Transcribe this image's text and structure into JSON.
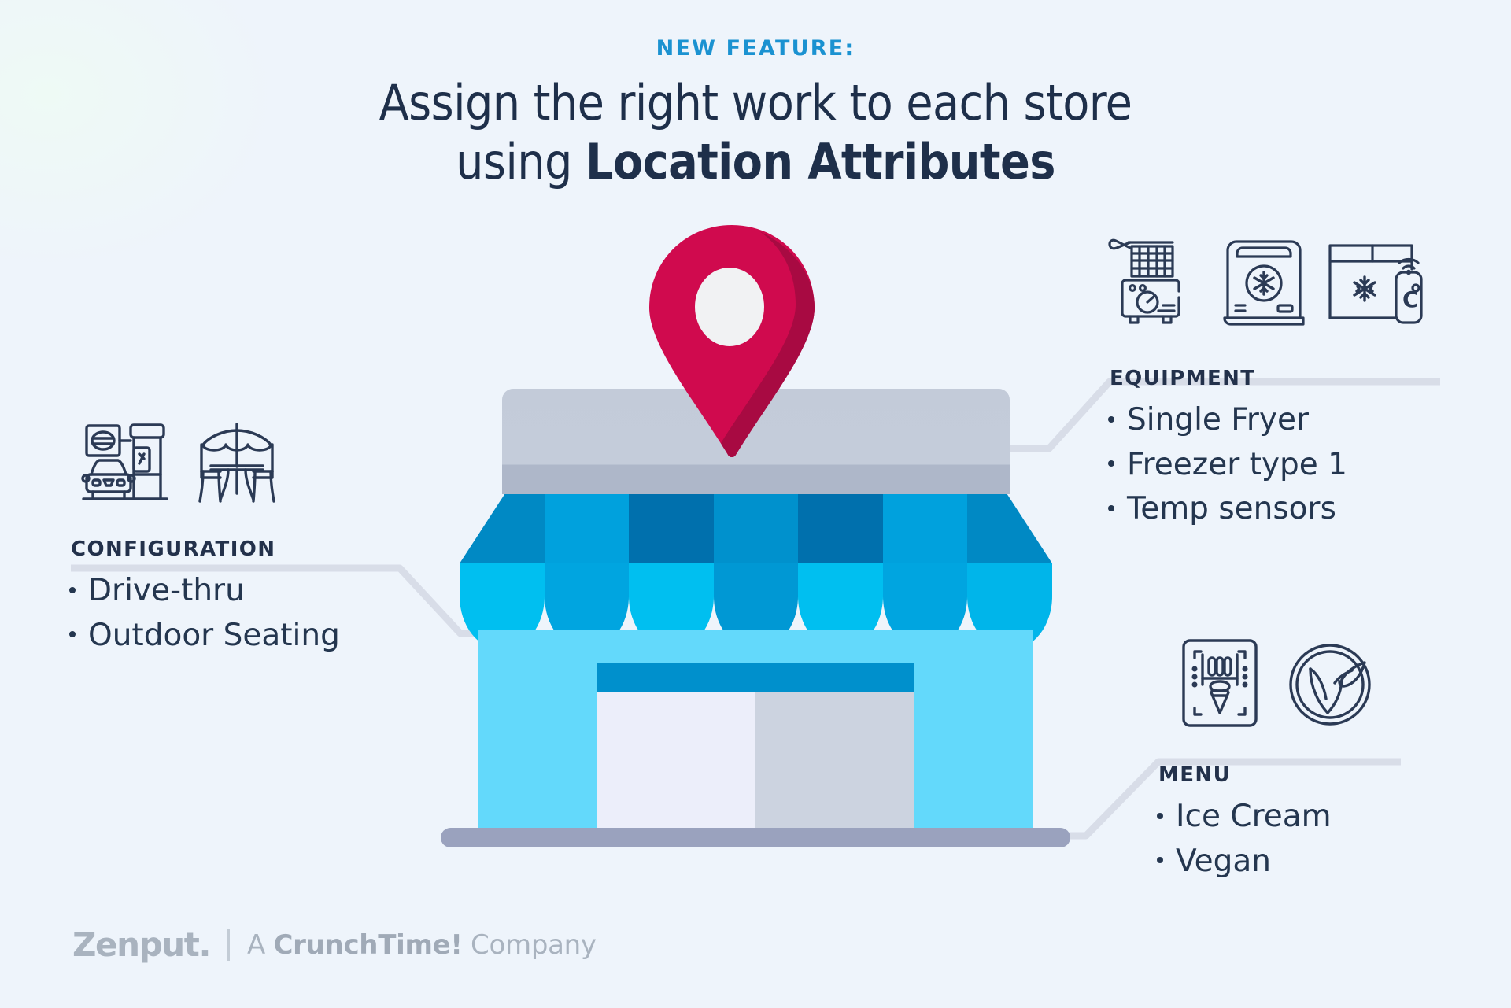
{
  "theme": {
    "background": "#eef4fb",
    "accent_blue": "#1b92d1",
    "headline_navy": "#1e2f4a",
    "body_navy": "#24364f",
    "pin_crimson": "#d00a4e",
    "pin_crimson_shadow": "#a80a42",
    "awning_light": "#00a9e8",
    "awning_mid": "#0089c4",
    "awning_dark": "#0070ad",
    "facade_cyan": "#63d9fb",
    "roof_gray": "#c4ccda",
    "base_gray": "#9aa2be",
    "connector_gray": "#d6dbe6",
    "footer_gray": "#a9b3bf"
  },
  "header": {
    "eyebrow": "NEW FEATURE:",
    "headline_line1": "Assign the right work to each store",
    "headline_line2_plain": "using ",
    "headline_line2_bold": "Location Attributes"
  },
  "illustration": {
    "name": "storefront-with-location-pin",
    "awning_scallop_count": 7,
    "pin_icon": "location-pin-icon"
  },
  "callouts": [
    {
      "id": "configuration",
      "kicker": "CONFIGURATION",
      "icons": [
        "drive-thru-icon",
        "outdoor-seating-icon"
      ],
      "items": [
        "Drive-thru",
        "Outdoor Seating"
      ]
    },
    {
      "id": "equipment",
      "kicker": "EQUIPMENT",
      "icons": [
        "fryer-icon",
        "freezer-icon",
        "temp-sensor-icon"
      ],
      "items": [
        "Single Fryer",
        "Freezer type 1",
        "Temp sensors"
      ]
    },
    {
      "id": "menu",
      "kicker": "MENU",
      "icons": [
        "ice-cream-machine-icon",
        "vegan-icon"
      ],
      "items": [
        "Ice Cream",
        "Vegan"
      ]
    }
  ],
  "footer": {
    "brand": "Zenput.",
    "tagline_prefix": "A ",
    "tagline_bold": "CrunchTime!",
    "tagline_suffix": " Company"
  }
}
